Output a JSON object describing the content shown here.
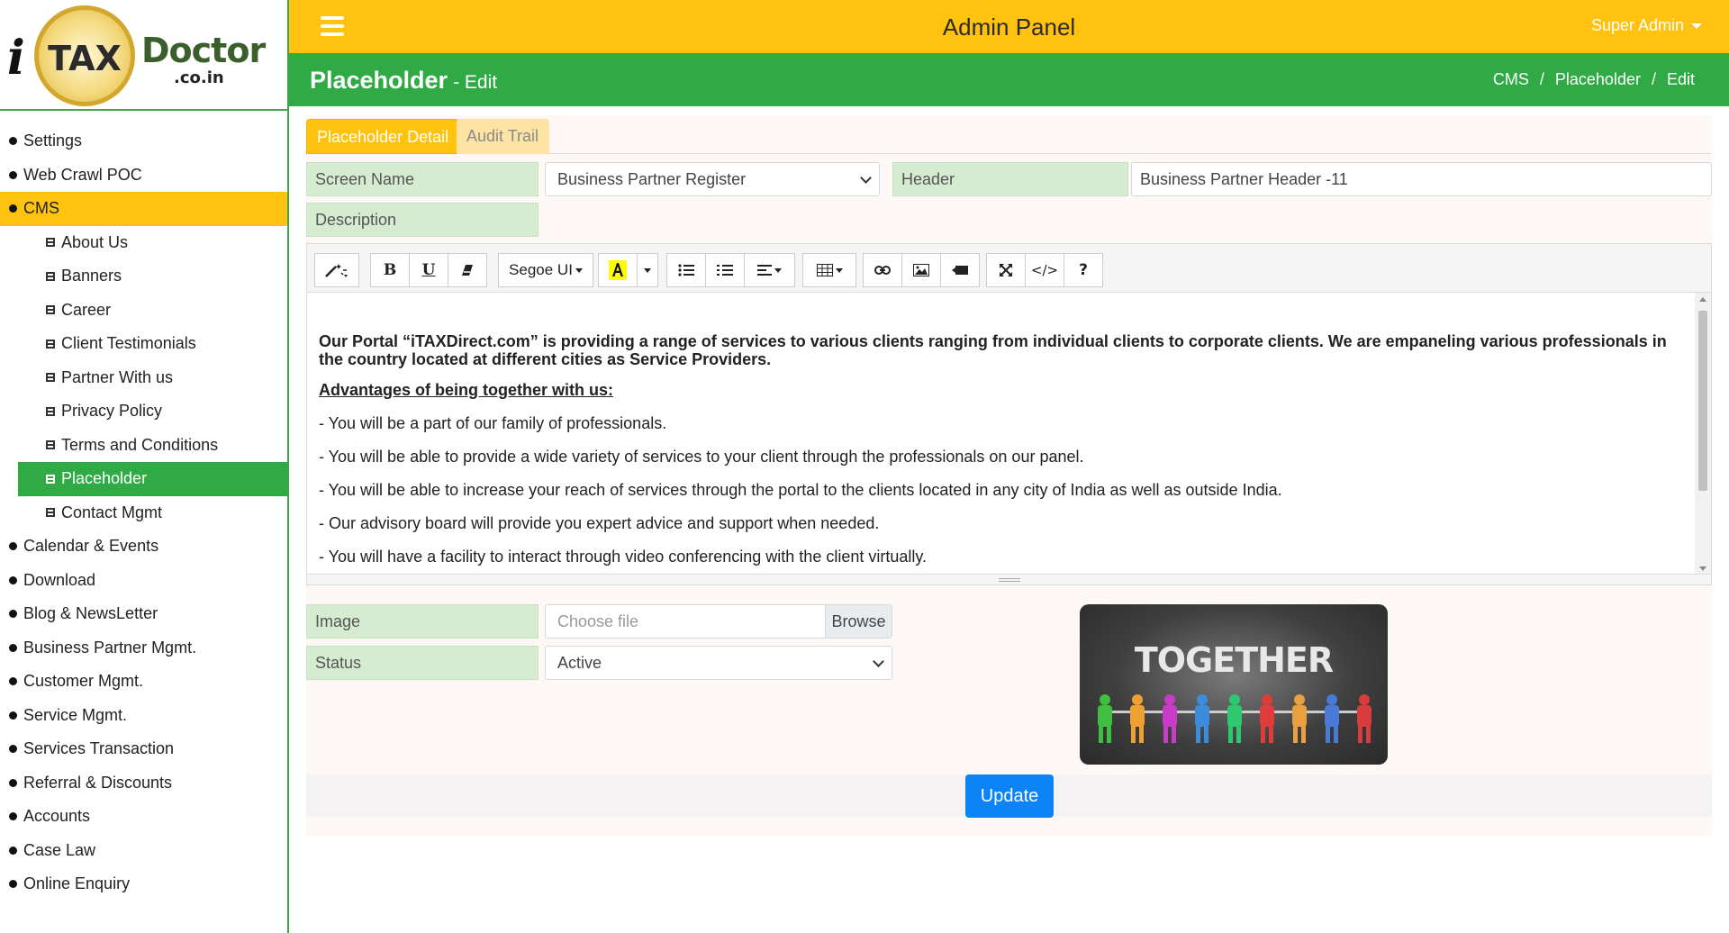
{
  "brand": {
    "prefix": "i",
    "seal_text": "TAX",
    "name": "Doctor",
    "domain": ".co.in"
  },
  "sidebar": {
    "items": [
      {
        "label": "Settings"
      },
      {
        "label": "Web Crawl POC"
      },
      {
        "label": "CMS",
        "active": true
      },
      {
        "label": "Calendar & Events"
      },
      {
        "label": "Download"
      },
      {
        "label": "Blog & NewsLetter"
      },
      {
        "label": "Business Partner Mgmt."
      },
      {
        "label": "Customer Mgmt."
      },
      {
        "label": "Service Mgmt."
      },
      {
        "label": "Services Transaction"
      },
      {
        "label": "Referral & Discounts"
      },
      {
        "label": "Accounts"
      },
      {
        "label": "Case Law"
      },
      {
        "label": "Online Enquiry"
      }
    ],
    "cms_items": [
      {
        "label": "About Us"
      },
      {
        "label": "Banners"
      },
      {
        "label": "Career"
      },
      {
        "label": "Client Testimonials"
      },
      {
        "label": "Partner With us"
      },
      {
        "label": "Privacy Policy"
      },
      {
        "label": "Terms and Conditions"
      },
      {
        "label": "Placeholder",
        "active": true
      },
      {
        "label": "Contact Mgmt"
      }
    ]
  },
  "topbar": {
    "title": "Admin Panel",
    "user": "Super Admin"
  },
  "titlebar": {
    "title": "Placeholder",
    "subtitle": "- Edit",
    "breadcrumb": [
      "CMS",
      "Placeholder",
      "Edit"
    ]
  },
  "tabs": [
    {
      "label": "Placeholder Detail"
    },
    {
      "label": "Audit Trail"
    }
  ],
  "form": {
    "screen_name_label": "Screen Name",
    "screen_name_value": "Business Partner Register",
    "header_label": "Header",
    "header_value": "Business Partner Header -11",
    "description_label": "Description",
    "image_label": "Image",
    "image_placeholder": "Choose file",
    "browse_label": "Browse",
    "status_label": "Status",
    "status_value": "Active",
    "update_label": "Update"
  },
  "editor": {
    "font_name": "Segoe UI",
    "intro": "Our Portal “iTAXDirect.com” is providing a range of services to various clients ranging from individual clients to corporate clients. We are empaneling various professionals in the country located at different cities as Service Providers.",
    "heading": "Advantages of being together with us:",
    "points": [
      "- You will be a part of our family of professionals.",
      "- You will be able to provide a wide variety of services to your client through the professionals on our panel.",
      "- You will be able to increase your reach of services through the portal to the clients located in any city of India as well as outside India.",
      "- Our advisory board will provide you expert advice and support when needed.",
      "- You will have a facility to interact through video conferencing with the client virtually."
    ]
  },
  "preview_image": {
    "text": "TOGETHER"
  },
  "colors": {
    "accent_yellow": "#ffc20e",
    "accent_green": "#2faa44",
    "primary_blue": "#0d84f5"
  }
}
